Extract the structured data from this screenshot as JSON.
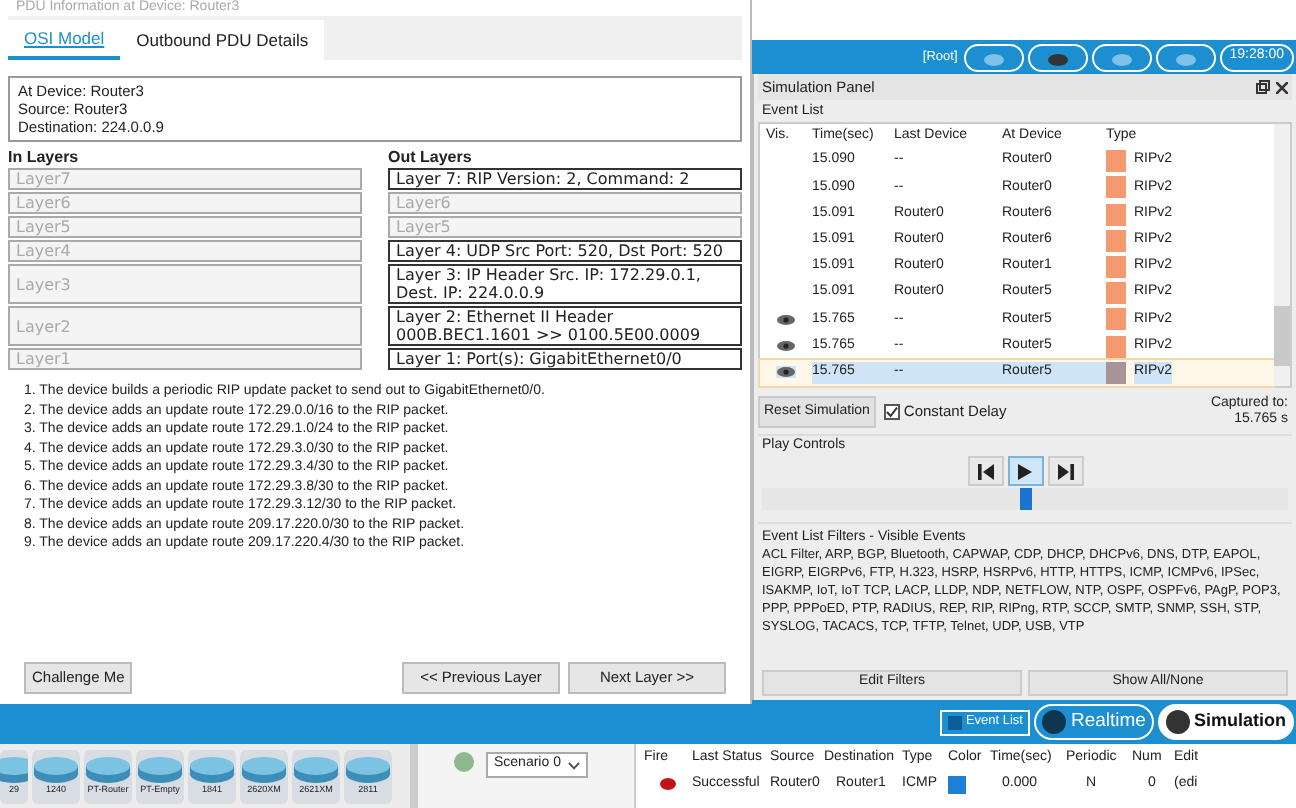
{
  "dialog": {
    "title": "PDU Information at Device: Router3",
    "tabs": [
      {
        "label": "OSI Model",
        "selected": true
      },
      {
        "label": "Outbound PDU Details",
        "selected": false
      }
    ],
    "info": [
      "At Device: Router3",
      "Source: Router3",
      "Destination: 224.0.0.9"
    ],
    "in_layers": {
      "heading": "In Layers",
      "layers": [
        {
          "label": "Layer7",
          "active": false,
          "kind": "single"
        },
        {
          "label": "Layer6",
          "active": false,
          "kind": "single"
        },
        {
          "label": "Layer5",
          "active": false,
          "kind": "single"
        },
        {
          "label": "Layer4",
          "active": false,
          "kind": "single"
        },
        {
          "label": "Layer3",
          "active": false,
          "kind": "double"
        },
        {
          "label": "Layer2",
          "active": false,
          "kind": "double"
        },
        {
          "label": "Layer1",
          "active": false,
          "kind": "single"
        }
      ]
    },
    "out_layers": {
      "heading": "Out Layers",
      "layers": [
        {
          "label": "Layer 7: RIP Version: 2, Command: 2",
          "active": true,
          "kind": "single"
        },
        {
          "label": "Layer6",
          "active": false,
          "kind": "single"
        },
        {
          "label": "Layer5",
          "active": false,
          "kind": "single"
        },
        {
          "label": "Layer 4: UDP Src Port: 520, Dst Port: 520",
          "active": true,
          "kind": "single"
        },
        {
          "label": "Layer 3: IP Header Src. IP: 172.29.0.1, Dest. IP: 224.0.0.9",
          "active": true,
          "kind": "double"
        },
        {
          "label": "Layer 2: Ethernet II Header 000B.BEC1.1601 >> 0100.5E00.0009",
          "active": true,
          "kind": "double"
        },
        {
          "label": "Layer 1: Port(s): GigabitEthernet0/0",
          "active": true,
          "kind": "single"
        }
      ]
    },
    "steps": [
      "1. The device builds a periodic RIP update packet to send out to GigabitEthernet0/0.",
      "2. The device adds an update route 172.29.0.0/16 to the RIP packet.",
      "3. The device adds an update route 172.29.1.0/24 to the RIP packet.",
      "4. The device adds an update route 172.29.3.0/30 to the RIP packet.",
      "5. The device adds an update route 172.29.3.4/30 to the RIP packet.",
      "6. The device adds an update route 172.29.3.8/30 to the RIP packet.",
      "7. The device adds an update route 172.29.3.12/30 to the RIP packet.",
      "8. The device adds an update route 209.17.220.0/30 to the RIP packet.",
      "9. The device adds an update route 209.17.220.4/30 to the RIP packet."
    ],
    "challenge_button": "Challenge Me",
    "previous_button": "<< Previous Layer",
    "next_button": "Next Layer >>"
  },
  "topbar": {
    "path": "[Root]",
    "time": "19:28:00"
  },
  "simulation_panel": {
    "title": "Simulation Panel",
    "event_list": {
      "label": "Event List",
      "columns": [
        "Vis.",
        "Time(sec)",
        "Last Device",
        "At Device",
        "Type"
      ],
      "rows": [
        {
          "vis": false,
          "time": "15.090",
          "last_device": "--",
          "at_device": "Router0",
          "type": "RIPv2",
          "color": "#f59a6e",
          "selected": false
        },
        {
          "vis": false,
          "time": "15.090",
          "last_device": "--",
          "at_device": "Router0",
          "type": "RIPv2",
          "color": "#f59a6e",
          "selected": false
        },
        {
          "vis": false,
          "time": "15.091",
          "last_device": "Router0",
          "at_device": "Router6",
          "type": "RIPv2",
          "color": "#f59a6e",
          "selected": false
        },
        {
          "vis": false,
          "time": "15.091",
          "last_device": "Router0",
          "at_device": "Router6",
          "type": "RIPv2",
          "color": "#f59a6e",
          "selected": false
        },
        {
          "vis": false,
          "time": "15.091",
          "last_device": "Router0",
          "at_device": "Router1",
          "type": "RIPv2",
          "color": "#f59a6e",
          "selected": false
        },
        {
          "vis": false,
          "time": "15.091",
          "last_device": "Router0",
          "at_device": "Router5",
          "type": "RIPv2",
          "color": "#f59a6e",
          "selected": false
        },
        {
          "vis": true,
          "time": "15.765",
          "last_device": "--",
          "at_device": "Router5",
          "type": "RIPv2",
          "color": "#f59a6e",
          "selected": false
        },
        {
          "vis": true,
          "time": "15.765",
          "last_device": "--",
          "at_device": "Router5",
          "type": "RIPv2",
          "color": "#f59a6e",
          "selected": false
        },
        {
          "vis": true,
          "time": "15.765",
          "last_device": "--",
          "at_device": "Router5",
          "type": "RIPv2",
          "color": "#a89396",
          "selected": true
        }
      ]
    },
    "reset_button": "Reset Simulation",
    "constant_delay": {
      "label": "Constant Delay",
      "checked": true
    },
    "captured_label": "Captured to:",
    "captured_value": "15.765 s",
    "play_controls": {
      "label": "Play Controls",
      "level": 0.5
    },
    "filters": {
      "heading": "Event List Filters - Visible Events",
      "text": "ACL Filter, ARP, BGP, Bluetooth, CAPWAP, CDP, DHCP, DHCPv6, DNS, DTP, EAPOL, EIGRP, EIGRPv6, FTP, H.323, HSRP, HSRPv6, HTTP, HTTPS, ICMP, ICMPv6, IPSec, ISAKMP, IoT, IoT TCP, LACP, LLDP, NDP, NETFLOW, NTP, OSPF, OSPFv6, PAgP, POP3, PPP, PPPoED, PTP, RADIUS, REP, RIP, RIPng, RTP, SCCP, SMTP, SNMP, SSH, STP, SYSLOG, TACACS, TCP, TFTP, Telnet, UDP, USB, VTP",
      "edit_button": "Edit Filters",
      "show_button": "Show All/None"
    }
  },
  "mode_bar": {
    "event_list_button": "Event List",
    "modes": [
      {
        "label": "Realtime",
        "selected": false
      },
      {
        "label": "Simulation",
        "selected": true
      }
    ]
  },
  "devices": [
    "29",
    "1240",
    "PT-Router",
    "PT-Empty",
    "1841",
    "2620XM",
    "2621XM",
    "2811"
  ],
  "scenario": {
    "value": "Scenario 0"
  },
  "pdu_table": {
    "columns": [
      "Fire",
      "Last Status",
      "Source",
      "Destination",
      "Type",
      "Color",
      "Time(sec)",
      "Periodic",
      "Num",
      "Edit"
    ],
    "rows": [
      {
        "last_status": "Successful",
        "source": "Router0",
        "destination": "Router1",
        "type": "ICMP",
        "color": "#1e7fd6",
        "time": "0.000",
        "periodic": "N",
        "num": "0",
        "edit": "(edi"
      }
    ]
  }
}
